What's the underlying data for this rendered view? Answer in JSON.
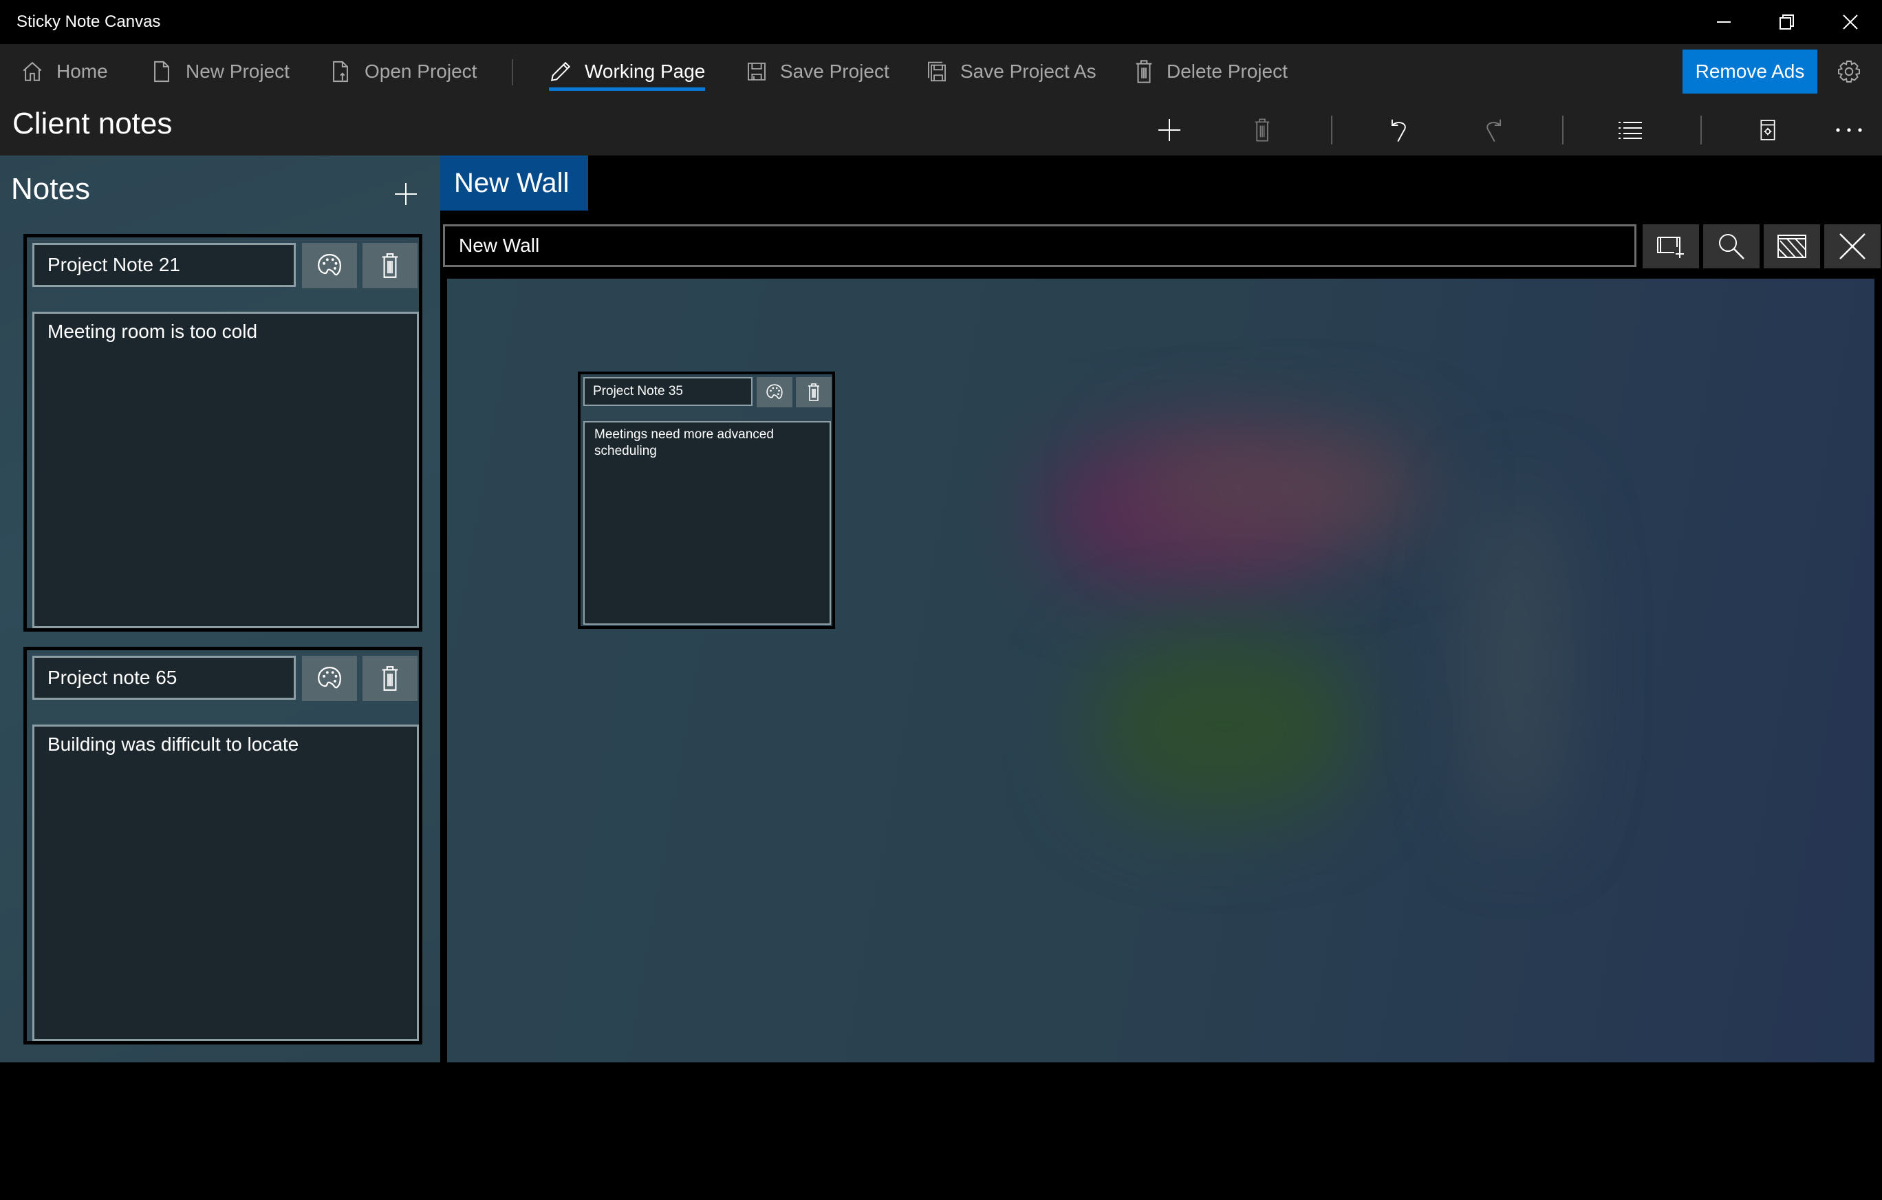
{
  "window": {
    "title": "Sticky Note Canvas",
    "controls": {
      "minimize": "minimize-icon",
      "restore": "restore-icon",
      "close": "close-icon"
    }
  },
  "nav": {
    "items": [
      {
        "label": "Home",
        "icon": "home-icon",
        "active": false
      },
      {
        "label": "New Project",
        "icon": "new-document-icon",
        "active": false
      },
      {
        "label": "Open Project",
        "icon": "open-document-icon",
        "active": false
      },
      {
        "label": "Working Page",
        "icon": "pencil-icon",
        "active": true
      },
      {
        "label": "Save Project",
        "icon": "save-icon",
        "active": false
      },
      {
        "label": "Save Project As",
        "icon": "save-as-icon",
        "active": false
      },
      {
        "label": "Delete Project",
        "icon": "trash-icon",
        "active": false
      }
    ],
    "remove_ads_label": "Remove Ads",
    "settings_icon": "gear-icon",
    "accent_color": "#0078d4"
  },
  "header": {
    "title": "Client notes",
    "commands": [
      {
        "name": "add",
        "icon": "plus-icon",
        "enabled": true
      },
      {
        "name": "delete",
        "icon": "trash-icon",
        "enabled": false
      },
      {
        "name": "undo",
        "icon": "undo-icon",
        "enabled": true
      },
      {
        "name": "redo",
        "icon": "redo-icon",
        "enabled": false
      },
      {
        "name": "list",
        "icon": "list-icon",
        "enabled": true
      },
      {
        "name": "page-settings",
        "icon": "page-settings-icon",
        "enabled": true
      },
      {
        "name": "more",
        "icon": "more-icon",
        "enabled": true
      }
    ]
  },
  "notes_panel": {
    "heading": "Notes",
    "add_icon": "plus-icon",
    "notes": [
      {
        "title": "Project Note 21",
        "body": "Meeting room is too cold"
      },
      {
        "title": "Project note 65",
        "body": "Building was difficult to locate"
      }
    ]
  },
  "wall": {
    "tab_label": "New Wall",
    "name_value": "New Wall",
    "tab_color": "#054a8a",
    "buttons": [
      {
        "name": "add-frame",
        "icon": "add-frame-icon"
      },
      {
        "name": "search",
        "icon": "search-icon"
      },
      {
        "name": "background",
        "icon": "hatch-pattern-icon"
      },
      {
        "name": "close",
        "icon": "close-icon"
      }
    ],
    "notes": [
      {
        "title": "Project Note 35",
        "body": "Meetings need more advanced scheduling"
      }
    ]
  }
}
